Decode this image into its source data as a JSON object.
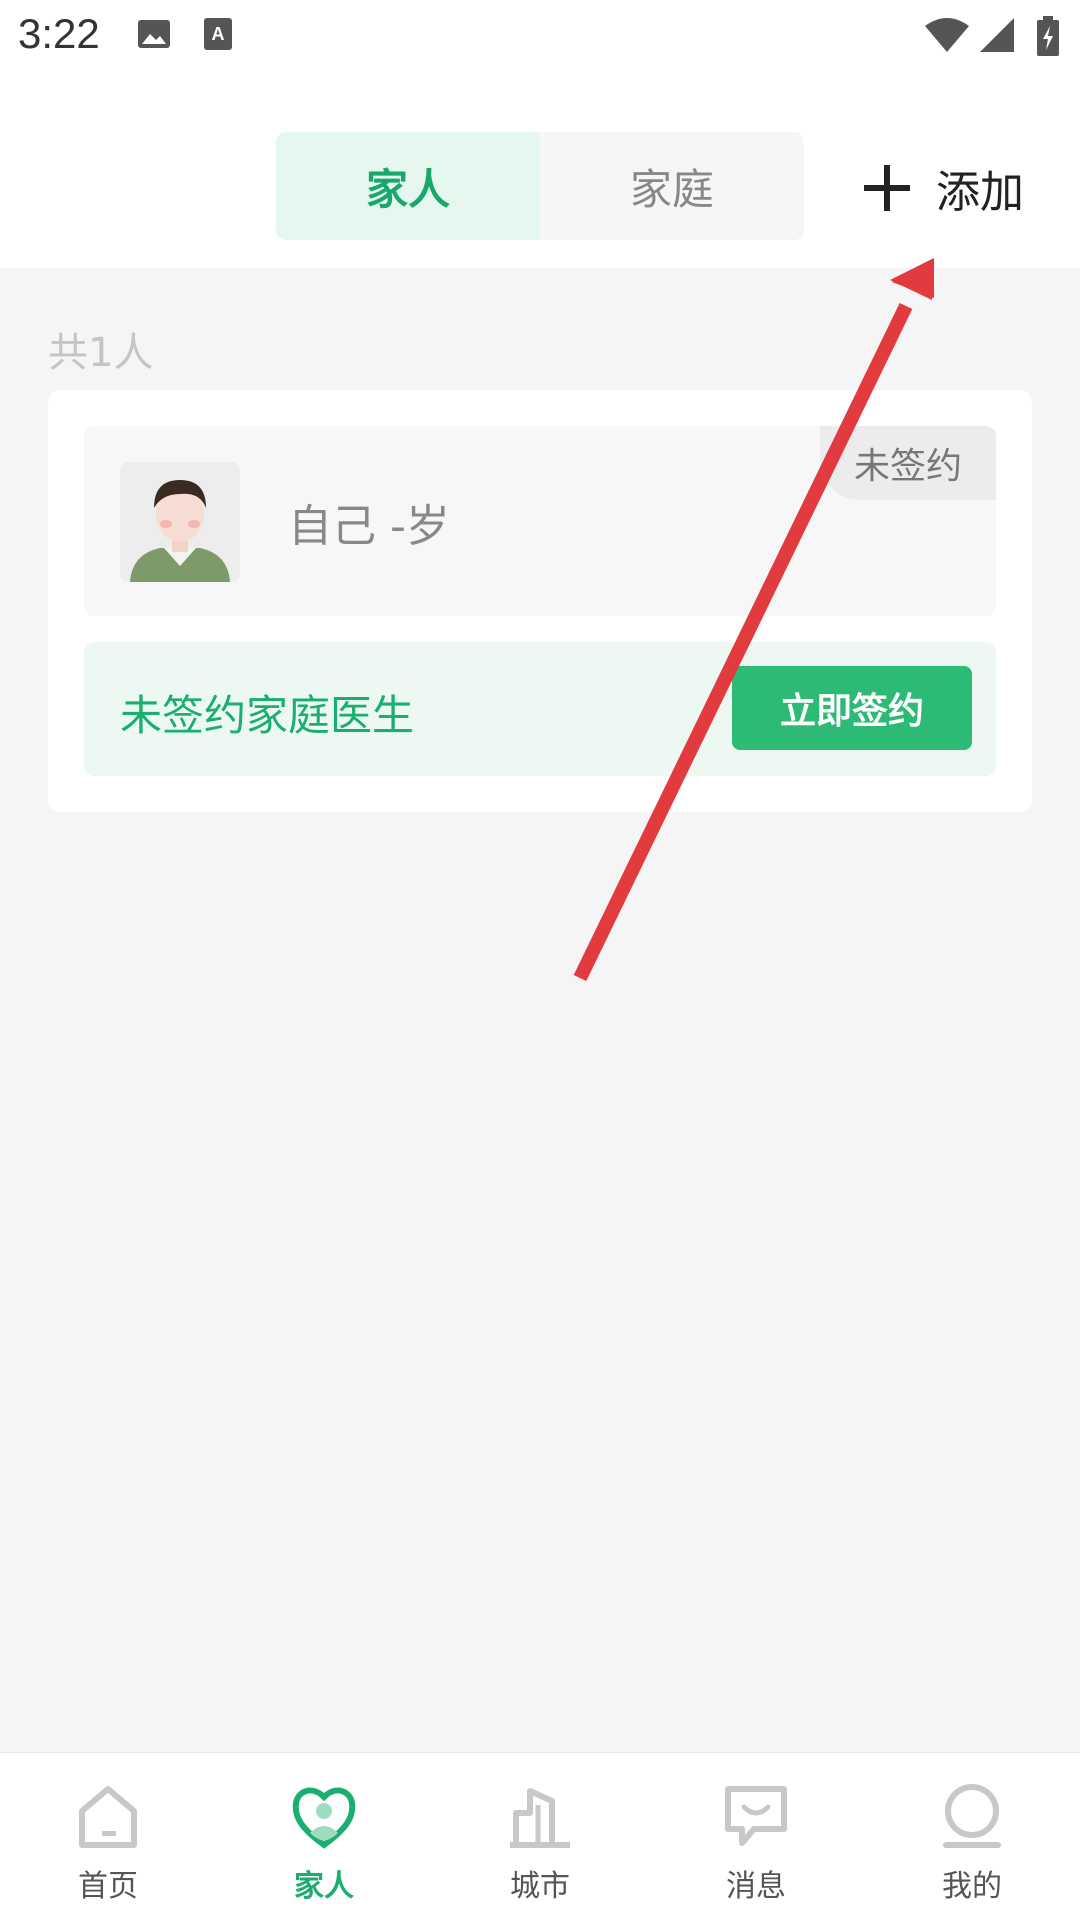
{
  "status_bar": {
    "time": "3:22"
  },
  "header": {
    "tabs": [
      {
        "label": "家人",
        "active": true
      },
      {
        "label": "家庭",
        "active": false
      }
    ],
    "add_label": "添加"
  },
  "member_count_text": "共1人",
  "member_card": {
    "name": "自己 -岁",
    "status_badge": "未签约",
    "sign_prompt": "未签约家庭医生",
    "sign_button": "立即签约"
  },
  "bottom_nav": [
    {
      "label": "首页",
      "icon": "home-icon",
      "active": false
    },
    {
      "label": "家人",
      "icon": "heart-person-icon",
      "active": true
    },
    {
      "label": "城市",
      "icon": "city-building-icon",
      "active": false
    },
    {
      "label": "消息",
      "icon": "message-icon",
      "active": false
    },
    {
      "label": "我的",
      "icon": "profile-icon",
      "active": false
    }
  ],
  "colors": {
    "accent": "#1aae6f",
    "button": "#2dba74",
    "annotation_arrow": "#e23b3f"
  }
}
